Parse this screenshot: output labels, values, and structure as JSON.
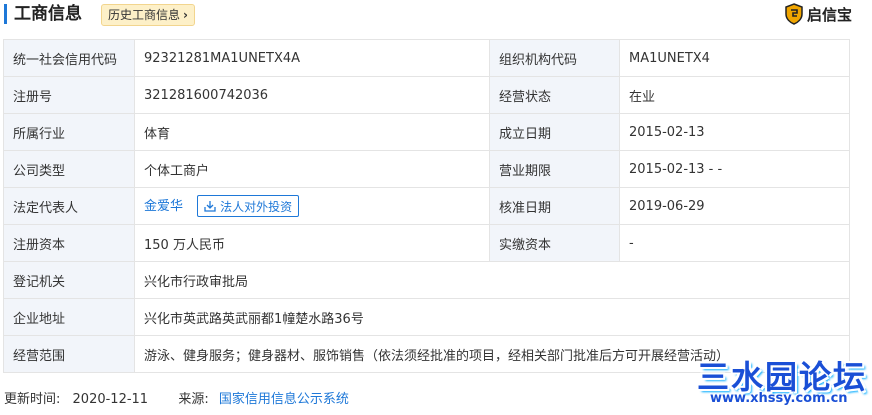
{
  "header": {
    "title": "工商信息",
    "history_button": "历史工商信息",
    "brand": "启信宝"
  },
  "rows": [
    {
      "l1": "统一社会信用代码",
      "v1": "92321281MA1UNETX4A",
      "l2": "组织机构代码",
      "v2": "MA1UNETX4"
    },
    {
      "l1": "注册号",
      "v1": "321281600742036",
      "l2": "经营状态",
      "v2": "在业"
    },
    {
      "l1": "所属行业",
      "v1": "体育",
      "l2": "成立日期",
      "v2": "2015-02-13"
    },
    {
      "l1": "公司类型",
      "v1": "个体工商户",
      "l2": "营业期限",
      "v2": "2015-02-13 - -"
    },
    {
      "l1": "法定代表人",
      "v1": "金爱华",
      "btn": "法人对外投资",
      "l2": "核准日期",
      "v2": "2019-06-29"
    },
    {
      "l1": "注册资本",
      "v1": "150 万人民币",
      "l2": "实缴资本",
      "v2": "-"
    },
    {
      "l1": "登记机关",
      "v1": "兴化市行政审批局"
    },
    {
      "l1": "企业地址",
      "v1": "兴化市英武路英武丽都1幢楚水路36号"
    },
    {
      "l1": "经营范围",
      "v1": "游泳、健身服务；健身器材、服饰销售（依法须经批准的项目，经相关部门批准后方可开展经营活动）"
    }
  ],
  "footer": {
    "update_label": "更新时间:",
    "update_value": "2020-12-11",
    "source_label": "来源:",
    "source_value": "国家信用信息公示系统"
  },
  "watermark": {
    "title": "三水园论坛",
    "url": "www.xhssy.com.cn"
  },
  "colors": {
    "accent": "#1e78d8",
    "label_bg": "#f2f5fa",
    "border": "#e4e4e4",
    "badge_bg": "#fdf0c8"
  }
}
